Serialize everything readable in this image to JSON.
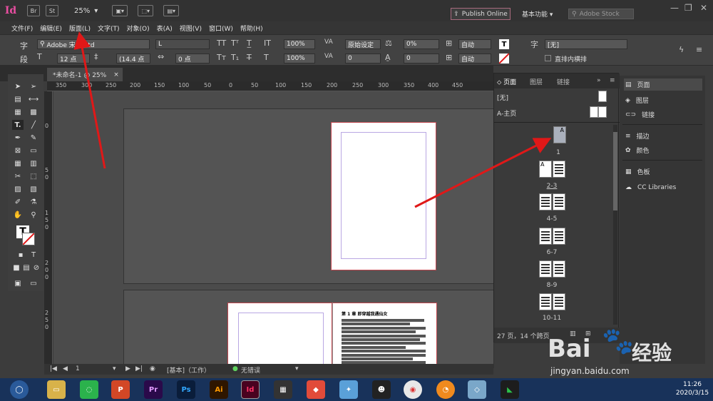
{
  "titlebar": {
    "app_logo": "Id",
    "bridge_btn": "Br",
    "stock_btn": "St",
    "zoom": "25%",
    "publish_online": "Publish Online",
    "workspace": "基本功能",
    "search_placeholder": "Adobe Stock"
  },
  "menu": [
    "文件(F)",
    "编辑(E)",
    "版面(L)",
    "文字(T)",
    "对象(O)",
    "表(A)",
    "视图(V)",
    "窗口(W)",
    "帮助(H)"
  ],
  "control": {
    "char_label": "字",
    "para_label": "段",
    "font_family": "Adobe 宋体 Std",
    "font_style": "L",
    "font_size": "12 点",
    "leading": "(14.4 点",
    "tracking_zero": "0 点",
    "h_scale": "100%",
    "v_scale": "100%",
    "kerning": "原始设定",
    "tracking": "0",
    "tsume": "0%",
    "baseline": "0",
    "auto1": "自动",
    "auto2": "自动",
    "char_style": "[无]",
    "vertical_label": "直排内横排",
    "t_button": "T"
  },
  "tabbar": {
    "doc_tab": "*未命名-1 @ 25%",
    "close": "×"
  },
  "ruler": {
    "h_ticks": [
      "350",
      "300",
      "250",
      "200",
      "150",
      "100",
      "50",
      "0",
      "50",
      "100",
      "150",
      "200",
      "250",
      "300",
      "350",
      "400",
      "450"
    ],
    "v_ticks": [
      "0",
      "5",
      "0",
      "1",
      "5",
      "0",
      "2",
      "0",
      "0",
      "2",
      "5",
      "0"
    ]
  },
  "status": {
    "page": "1",
    "master": "[基本]（工作）",
    "preflight": "无错误"
  },
  "pages_panel": {
    "tabs": [
      "页面",
      "图层",
      "链接"
    ],
    "none_master": "[无]",
    "a_master": "A-主页",
    "page_labels": [
      "1",
      "2-3",
      "4-5",
      "6-7",
      "8-9",
      "10-11"
    ],
    "master_letter": "A",
    "footer": "27 页，14 个跨页",
    "colors": {
      "selected_page": "#aab0bc"
    }
  },
  "dock": {
    "items": [
      "页面",
      "图层",
      "链接",
      "描边",
      "颜色",
      "色板",
      "CC Libraries"
    ]
  },
  "taskbar": {
    "apps": [
      "Pr",
      "Ps",
      "Ai",
      "Id"
    ],
    "time": "11:26",
    "date": "2020/3/15"
  },
  "watermark": {
    "brand_left": "Bai",
    "brand_right": "经验",
    "url": "jingyan.baidu.com"
  },
  "doc_heading": "第 1 章 即穿越我遇仙女"
}
